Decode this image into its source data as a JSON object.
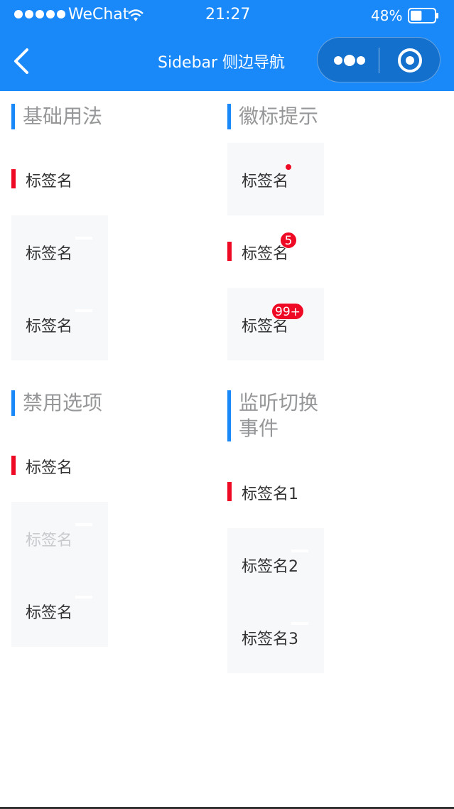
{
  "status_bar": {
    "carrier": "WeChat",
    "time": "21:27",
    "battery": "48%",
    "battery_level": 0.48
  },
  "navbar": {
    "title": "Sidebar 侧边导航"
  },
  "sections": {
    "basic": {
      "title": "基础用法",
      "items": [
        "标签名",
        "标签名",
        "标签名"
      ]
    },
    "badge": {
      "title": "徽标提示",
      "items": [
        "标签名",
        "标签名",
        "标签名"
      ],
      "badge_count": "5",
      "badge_overflow": "99+"
    },
    "disabled": {
      "title": "禁用选项",
      "items": [
        "标签名",
        "标签名",
        "标签名"
      ]
    },
    "change": {
      "title_line1": "监听切换",
      "title_line2": "事件",
      "items": [
        "标签名1",
        "标签名2",
        "标签名3"
      ]
    }
  },
  "colors": {
    "brand": "#1989fa",
    "active_bar": "#ee0a24",
    "sidebar_bg": "#f7f8fa",
    "title_text": "#969799",
    "item_text": "#323233",
    "disabled_text": "#c8c9cc"
  }
}
